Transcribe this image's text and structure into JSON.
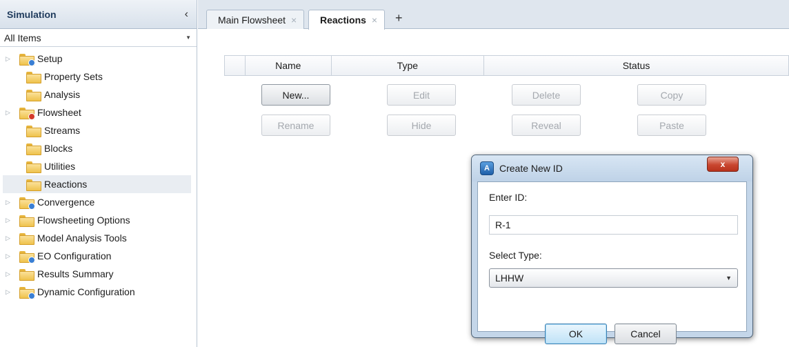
{
  "sidebar": {
    "title": "Simulation",
    "collapse_glyph": "‹",
    "filter": {
      "value": "All Items"
    },
    "items": [
      {
        "label": "Setup",
        "has_expander": true,
        "badge": "blue",
        "child": false
      },
      {
        "label": "Property Sets",
        "has_expander": false,
        "badge": "",
        "child": true
      },
      {
        "label": "Analysis",
        "has_expander": false,
        "badge": "",
        "child": true
      },
      {
        "label": "Flowsheet",
        "has_expander": true,
        "badge": "red",
        "child": false
      },
      {
        "label": "Streams",
        "has_expander": false,
        "badge": "",
        "child": true
      },
      {
        "label": "Blocks",
        "has_expander": false,
        "badge": "",
        "child": true
      },
      {
        "label": "Utilities",
        "has_expander": false,
        "badge": "",
        "child": true
      },
      {
        "label": "Reactions",
        "has_expander": false,
        "badge": "",
        "child": true,
        "selected": true
      },
      {
        "label": "Convergence",
        "has_expander": true,
        "badge": "blue",
        "child": false
      },
      {
        "label": "Flowsheeting Options",
        "has_expander": true,
        "badge": "",
        "child": false
      },
      {
        "label": "Model Analysis Tools",
        "has_expander": true,
        "badge": "",
        "child": false
      },
      {
        "label": "EO Configuration",
        "has_expander": true,
        "badge": "blue",
        "child": false
      },
      {
        "label": "Results Summary",
        "has_expander": true,
        "badge": "",
        "child": false
      },
      {
        "label": "Dynamic Configuration",
        "has_expander": true,
        "badge": "blue",
        "child": false
      }
    ]
  },
  "tabs": [
    {
      "label": "Main Flowsheet",
      "close": "×"
    },
    {
      "label": "Reactions",
      "close": "×",
      "active": true
    }
  ],
  "tab_add": "+",
  "grid": {
    "columns": [
      "",
      "Name",
      "Type",
      "Status"
    ]
  },
  "buttons": {
    "new": "New...",
    "edit": "Edit",
    "delete": "Delete",
    "copy": "Copy",
    "rename": "Rename",
    "hide": "Hide",
    "reveal": "Reveal",
    "paste": "Paste"
  },
  "dialog": {
    "title": "Create New ID",
    "close_glyph": "x",
    "enter_id_label": "Enter ID:",
    "id_value": "R-1",
    "select_type_label": "Select Type:",
    "type_value": "LHHW",
    "ok": "OK",
    "cancel": "Cancel"
  },
  "colors": {
    "sidebar_title": "#1e3a5c",
    "folder": "#efc24c",
    "badge_blue": "#3a7fd4",
    "badge_red": "#d43a2a",
    "dialog_frame": "#c4d6e9",
    "close_button": "#c9462f"
  },
  "icons": {
    "folder": "folder-icon",
    "expander": "triangle-right-icon",
    "app": "aspen-app-icon"
  }
}
